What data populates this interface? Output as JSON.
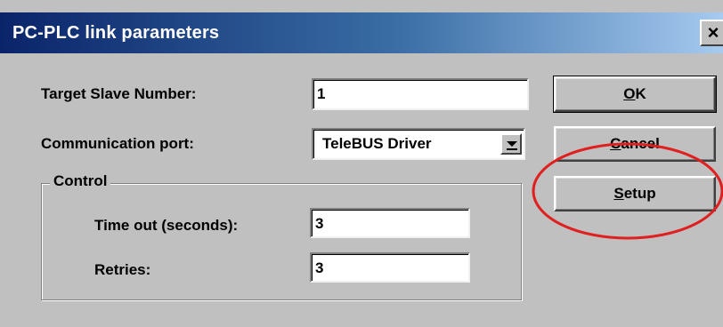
{
  "dialog": {
    "title": "PC-PLC link parameters",
    "close_glyph": "×"
  },
  "form": {
    "target_slave_label": "Target Slave Number:",
    "target_slave_value": "1",
    "comm_port_label": "Communication port:",
    "comm_port_value": "TeleBUS Driver",
    "control_group_label": "Control",
    "timeout_label": "Time out (seconds):",
    "timeout_value": "3",
    "retries_label": "Retries:",
    "retries_value": "3"
  },
  "buttons": {
    "ok": {
      "mnemonic": "O",
      "rest": "K"
    },
    "cancel": {
      "mnemonic": "C",
      "rest": "ancel"
    },
    "setup": {
      "mnemonic": "S",
      "rest": "etup"
    }
  },
  "icons": {
    "close": "close-icon",
    "dropdown": "chevron-down-icon"
  },
  "colors": {
    "dialog_bg": "#c0c0c0",
    "titlebar_start": "#0a246a",
    "titlebar_end": "#a6caf0",
    "highlight": "#e02020"
  }
}
